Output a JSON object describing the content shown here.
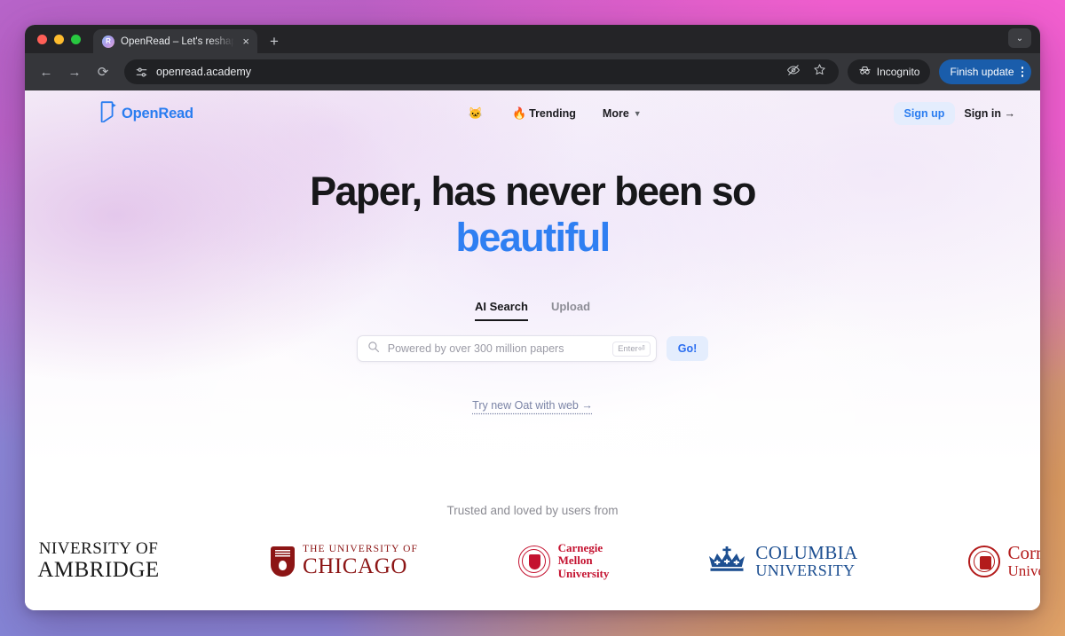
{
  "browser": {
    "tab": {
      "title": "OpenRead – Let's reshape res",
      "favicon": "openread-favicon-icon",
      "close": "×",
      "new_tab": "+"
    },
    "window_chevron": "⌄",
    "toolbar": {
      "back": "←",
      "forward": "→",
      "reload": "⟳",
      "site_settings_icon": "tune-icon",
      "url": "openread.academy",
      "hide_password_icon": "eye-slash-icon",
      "bookmark_icon": "star-icon",
      "incognito_label": "Incognito",
      "incognito_icon": "incognito-hat-icon",
      "update_label": "Finish update",
      "menu_icon": "kebab-menu-icon"
    }
  },
  "site": {
    "brand": {
      "name": "OpenRead",
      "logo_icon": "openread-book-icon",
      "color": "#2a7df0"
    },
    "nav": [
      {
        "label": "",
        "icon": "octocat-icon",
        "emoji": "🐱"
      },
      {
        "label": "Trending",
        "icon": "fire-icon",
        "emoji": "🔥"
      },
      {
        "label": "More",
        "icon": "chevron-down-icon",
        "emoji": ""
      }
    ],
    "auth": {
      "sign_up": "Sign up",
      "sign_in": "Sign in →",
      "sign_up_bg": "#e4edfd",
      "sign_up_color": "#2a7df0"
    },
    "hero": {
      "headline_line1": "Paper, has never been so",
      "headline_line2": "beautiful",
      "accent_color": "#2f7ff2"
    },
    "search_tabs": [
      {
        "label": "AI Search",
        "active": true
      },
      {
        "label": "Upload",
        "active": false
      }
    ],
    "search": {
      "icon": "search-icon",
      "placeholder": "Powered by over 300 million papers",
      "value": "",
      "enter_badge": "Enter⏎",
      "go_label": "Go!"
    },
    "oat_link": "Try new Oat with web →",
    "trusted": {
      "title": "Trusted and loved by users from",
      "logos": [
        {
          "name": "University of Cambridge",
          "line1": "NIVERSITY OF",
          "line2": "AMBRIDGE",
          "color": "#1a1a1a",
          "clipped": "left"
        },
        {
          "name": "The University of Chicago",
          "line1": "THE UNIVERSITY OF",
          "line2": "CHICAGO",
          "color": "#8c1515",
          "icon": "chicago-shield-icon"
        },
        {
          "name": "Carnegie Mellon University",
          "line1": "Carnegie",
          "line2": "Mellon",
          "line3": "University",
          "color": "#c41230",
          "icon": "cmu-seal-icon"
        },
        {
          "name": "Columbia University",
          "line1": "COLUMBIA",
          "line2": "UNIVERSITY",
          "color": "#1d4f91",
          "icon": "columbia-crown-icon"
        },
        {
          "name": "Cornell University",
          "line1": "Corn",
          "line2": "Unive",
          "color": "#b31b1b",
          "icon": "cornell-seal-icon",
          "clipped": "right"
        }
      ]
    }
  }
}
